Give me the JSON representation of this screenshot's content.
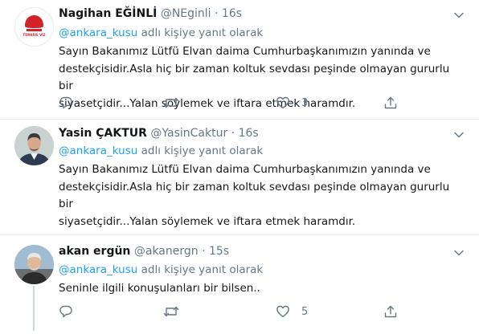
{
  "colors": {
    "accent": "#1da1f2",
    "muted": "#657786",
    "text": "#14171a",
    "divider": "#e6ecf0"
  },
  "tweets": [
    {
      "display_name": "Nagihan EĞİNLİ",
      "handle": "@NEginli",
      "separator": "·",
      "time": "16s",
      "reply_mention": "@ankara_kusu",
      "reply_suffix": " adlı kişiye yanıt olarak",
      "avatar_label": "TÜRKİYE VİZ",
      "text": "Sayın Bakanımız Lütfü Elvan daima Cumhurbaşkanımızın yanında ve\ndestekçisidir.Asla hiç bir zaman koltuk sevdası peşinde olmayan gururlu bir\nsiyasetçidir...Yalan söylemek ve iftara etmek haramdır.",
      "reply_count": "",
      "retweet_count": "",
      "like_count": "3"
    },
    {
      "display_name": "Yasin ÇAKTUR",
      "handle": "@YasinCaktur",
      "separator": "·",
      "time": "16s",
      "reply_mention": "@ankara_kusu",
      "reply_suffix": " adlı kişiye yanıt olarak",
      "text": "Sayın Bakanımız Lütfü Elvan daima Cumhurbaşkanımızın yanında ve\ndestekçisidir.Asla hiç bir zaman koltuk sevdası peşinde olmayan gururlu bir\nsiyasetçidir...Yalan söylemek ve iftara etmek haramdır.",
      "reply_count": "",
      "retweet_count": "",
      "like_count": ""
    },
    {
      "display_name": "akan ergün",
      "handle": "@akanergn",
      "separator": "·",
      "time": "15s",
      "reply_mention": "@ankara_kusu",
      "reply_suffix": " adlı kişiye yanıt olarak",
      "text": "Seninle ilgili konuşulanları bir bilsen..",
      "reply_count": "",
      "retweet_count": "",
      "like_count": "5"
    }
  ],
  "icons": {
    "more": "chevron-down-icon",
    "reply": "reply-icon",
    "retweet": "retweet-icon",
    "like": "heart-icon",
    "share": "share-icon"
  }
}
